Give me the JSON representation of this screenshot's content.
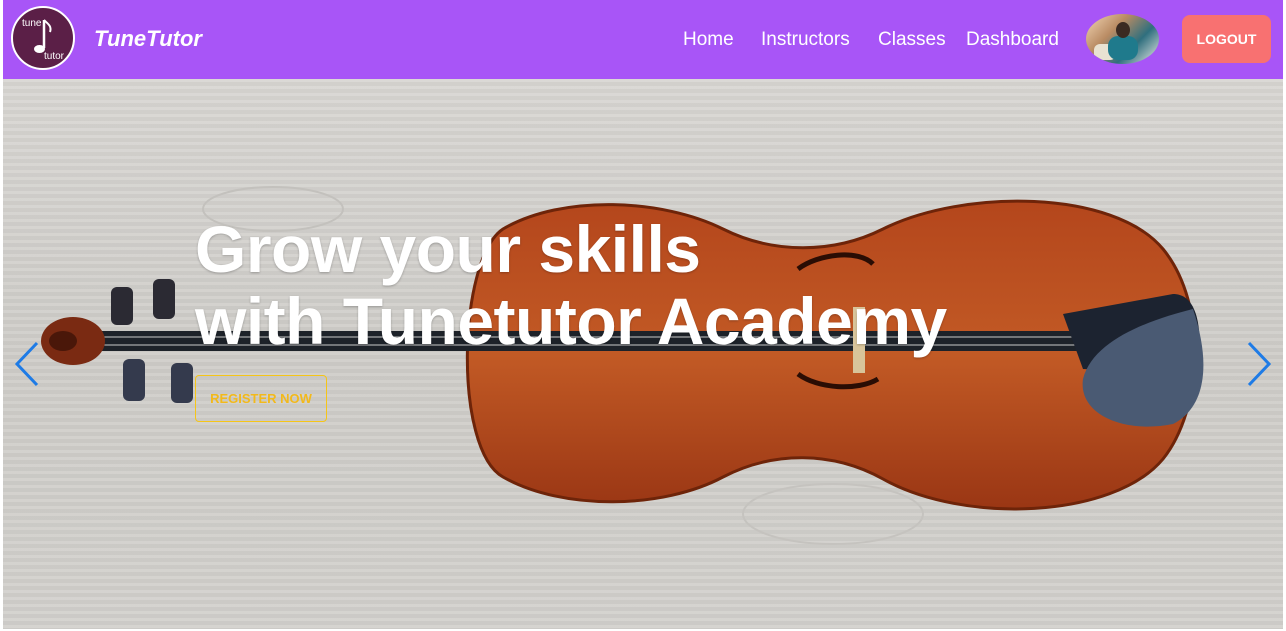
{
  "brand": {
    "logo_top": "tune",
    "logo_bottom": "tutor",
    "name": "TuneTutor",
    "logo_icon": "music-note-icon"
  },
  "nav": {
    "items": [
      {
        "label": "Home"
      },
      {
        "label": "Instructors"
      },
      {
        "label": "Classes"
      },
      {
        "label": "Dashboard"
      }
    ],
    "logout_label": "LOGOUT"
  },
  "hero": {
    "title_line1": "Grow your skills",
    "title_line2": "with Tunetutor Academy",
    "cta_label": "REGISTER NOW",
    "prev_icon": "chevron-left-icon",
    "next_icon": "chevron-right-icon"
  },
  "colors": {
    "navbar": "#a855f7",
    "logout": "#f87171",
    "cta": "#f5c518",
    "arrows": "#1e7be6"
  }
}
